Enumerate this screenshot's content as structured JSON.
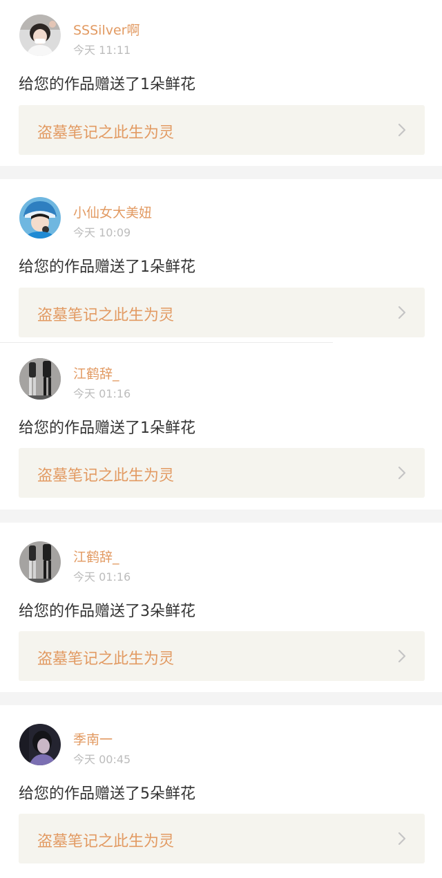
{
  "notifications": [
    {
      "username": "SSSilver啊",
      "time": "今天 11:11",
      "message": "给您的作品赠送了1朵鲜花",
      "work_title": "盗墓笔记之此生为灵",
      "avatar_icon": "avatar-girl-white-top"
    },
    {
      "username": "小仙女大美妞",
      "time": "今天 10:09",
      "message": "给您的作品赠送了1朵鲜花",
      "work_title": "盗墓笔记之此生为灵",
      "avatar_icon": "avatar-girl-blue-hat"
    },
    {
      "username": "江鹤辞_",
      "time": "今天 01:16",
      "message": "给您的作品赠送了1朵鲜花",
      "work_title": "盗墓笔记之此生为灵",
      "avatar_icon": "avatar-figures-dark"
    },
    {
      "username": "江鹤辞_",
      "time": "今天 01:16",
      "message": "给您的作品赠送了3朵鲜花",
      "work_title": "盗墓笔记之此生为灵",
      "avatar_icon": "avatar-figures-dark"
    },
    {
      "username": "季南一",
      "time": "今天 00:45",
      "message": "给您的作品赠送了5朵鲜花",
      "work_title": "盗墓笔记之此生为灵",
      "avatar_icon": "avatar-person-dark-purple"
    }
  ],
  "colors": {
    "accent": "#e29a62",
    "timestamp": "#bcbcbc",
    "message": "#333333",
    "link_background": "#f5f4ee",
    "separator": "#f4f4f4",
    "chevron": "#c4c4c4"
  }
}
